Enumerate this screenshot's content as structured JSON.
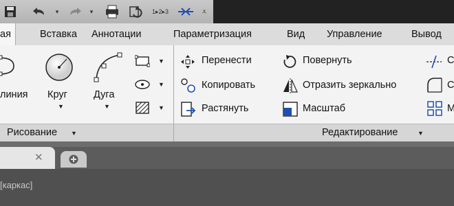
{
  "tabs": {
    "active": "ая",
    "items": [
      "Вставка",
      "Аннотации",
      "Параметризация",
      "Вид",
      "Управление",
      "Вывод"
    ]
  },
  "quick_access": {
    "sequence_label": "1▸2▸3",
    "icons": [
      "save-icon",
      "undo-icon",
      "redo-icon",
      "plot-icon",
      "refresh-icon",
      "sequence-icon",
      "join-icon",
      "customize-icon"
    ]
  },
  "draw_panel": {
    "line_label": "линия",
    "circle_label": "Круг",
    "arc_label": "Дуга",
    "title": "Рисование"
  },
  "modify_panel": {
    "move": "Перенести",
    "rotate": "Повернуть",
    "copy": "Копировать",
    "mirror": "Отразить зеркально",
    "stretch": "Растянуть",
    "scale": "Масштаб",
    "fillet_partial": "С",
    "title": "Редактирование"
  },
  "viewport": {
    "label": "[каркас]"
  },
  "colors": {
    "ribbon_bg": "#f3f3f3",
    "tabbar_bg": "#dcdcdc",
    "viewport_bg": "#505050"
  }
}
